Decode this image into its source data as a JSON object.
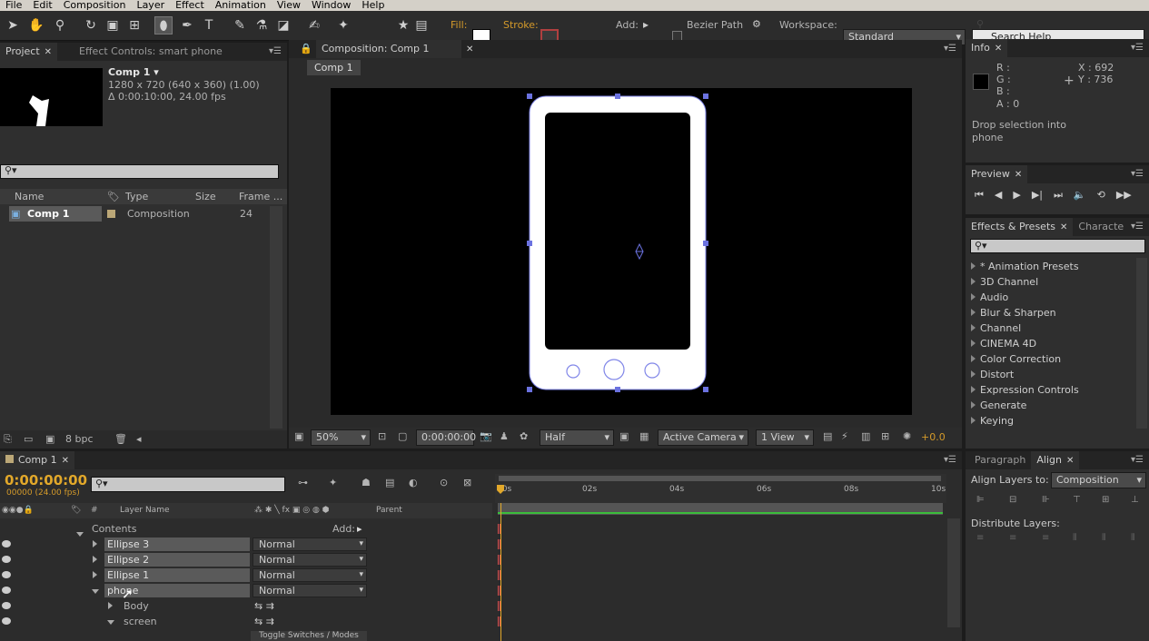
{
  "menu": [
    "File",
    "Edit",
    "Composition",
    "Layer",
    "Effect",
    "Animation",
    "View",
    "Window",
    "Help"
  ],
  "toolbar": {
    "fill_label": "Fill:",
    "stroke_label": "Stroke:",
    "add_label": "Add:",
    "bezier_label": "Bezier Path",
    "workspace_label": "Workspace:",
    "workspace_value": "Standard",
    "search_placeholder": "Search Help",
    "fill_color": "#ffffff",
    "stroke_color": "#b04040"
  },
  "project": {
    "tab_project": "Project",
    "tab_effects": "Effect Controls: smart phone",
    "comp_name": "Comp 1 ▾",
    "comp_info1": "1280 x 720  (640 x 360) (1.00)",
    "comp_info2": "Δ 0:00:10:00, 24.00 fps",
    "col_name": "Name",
    "col_type": "Type",
    "col_size": "Size",
    "col_frame": "Frame ...",
    "item_name": "Comp 1",
    "item_type": "Composition",
    "item_frame": "24",
    "bpc": "8 bpc"
  },
  "composition": {
    "tab": "Composition: Comp 1",
    "crumb": "Comp 1",
    "zoom": "50%",
    "timecode": "0:00:00:00",
    "resolution": "Half",
    "camera": "Active Camera",
    "views": "1 View",
    "exposure": "+0.0"
  },
  "info": {
    "tab": "Info",
    "r": "R :",
    "g": "G :",
    "b": "B :",
    "a": "A : 0",
    "x": "X : 692",
    "y": "Y : 736",
    "message": "Drop selection into phone"
  },
  "preview": {
    "tab": "Preview"
  },
  "effects": {
    "tab": "Effects & Presets",
    "tab2": "Characte",
    "items": [
      "* Animation Presets",
      "3D Channel",
      "Audio",
      "Blur & Sharpen",
      "Channel",
      "CINEMA 4D",
      "Color Correction",
      "Distort",
      "Expression Controls",
      "Generate",
      "Keying"
    ]
  },
  "timeline": {
    "tab": "Comp 1",
    "timecode": "0:00:00:00",
    "fps": "00000 (24.00 fps)",
    "col_hash": "#",
    "col_layer": "Layer Name",
    "col_parent": "Parent",
    "contents": "Contents",
    "add": "Add:",
    "layers": [
      {
        "name": "Ellipse 3",
        "mode": "Normal"
      },
      {
        "name": "Ellipse 2",
        "mode": "Normal"
      },
      {
        "name": "Ellipse 1",
        "mode": "Normal"
      },
      {
        "name": "phone",
        "mode": "Normal"
      }
    ],
    "sub": [
      "Body",
      "screen"
    ],
    "ruler": [
      "00s",
      "02s",
      "04s",
      "06s",
      "08s",
      "10s"
    ],
    "toggle": "Toggle Switches / Modes"
  },
  "align": {
    "tab_para": "Paragraph",
    "tab_align": "Align",
    "align_to_label": "Align Layers to:",
    "align_to": "Composition",
    "distribute": "Distribute Layers:"
  }
}
